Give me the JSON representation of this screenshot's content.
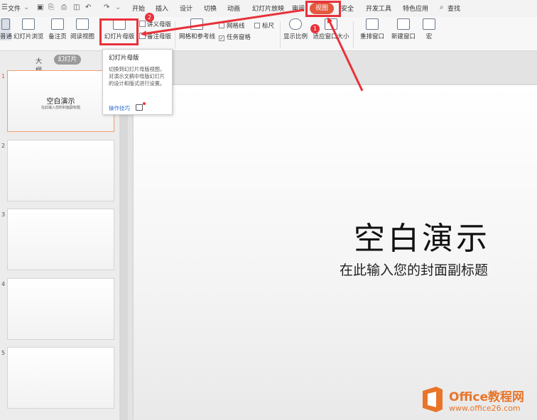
{
  "menubar": {
    "file": "文件",
    "tabs": [
      "开始",
      "插入",
      "设计",
      "切换",
      "动画",
      "幻灯片放映",
      "审阅",
      "视图",
      "安全",
      "开发工具",
      "特色应用"
    ],
    "active_tab": "视图",
    "search": "查找"
  },
  "ribbon": {
    "normal": "普通",
    "slide_sorter": "幻灯片浏览",
    "notes_page": "备注页",
    "reading_view": "阅读视图",
    "slide_master": "幻灯片母版",
    "handout_master": "讲义母版",
    "notes_master": "备注母版",
    "grid_guides": "网格和参考线",
    "gridlines": "网格线",
    "ruler": "标尺",
    "task_pane": "任务窗格",
    "zoom": "显示比例",
    "fit_window": "适应窗口大小",
    "arrange": "重排窗口",
    "new_window": "新建窗口",
    "macro": "宏"
  },
  "panel": {
    "outline_tab": "大纲",
    "slides_tab": "幻灯片"
  },
  "thumbnails": [
    {
      "num": "1",
      "title": "空白演示",
      "subtitle": "在此输入您的封面副标题"
    },
    {
      "num": "2"
    },
    {
      "num": "3"
    },
    {
      "num": "4"
    },
    {
      "num": "5"
    }
  ],
  "slide": {
    "title": "空白演示",
    "subtitle": "在此输入您的封面副标题"
  },
  "tooltip": {
    "title": "幻灯片母版",
    "description": "切换到幻灯片母版视图，对演示文稿中母版幻灯片的设计和版式进行设置。",
    "link": "操作技巧"
  },
  "annotations": {
    "badge1": "1",
    "badge2": "2",
    "color": "#e8313a"
  },
  "watermark": {
    "brand": "Office教程网",
    "url": "www.office26.com"
  }
}
